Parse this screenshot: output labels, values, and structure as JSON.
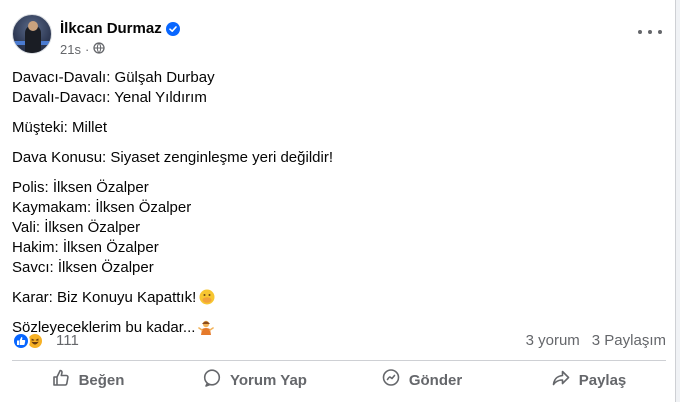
{
  "post": {
    "author": "İlkcan Durmaz",
    "time": "21s",
    "lines": {
      "p1a": "Davacı-Davalı: Gülşah Durbay",
      "p1b": "Davalı-Davacı: Yenal Yıldırım",
      "p2": "Müşteki: Millet",
      "p3": "Dava Konusu: Siyaset zenginleşme yeri değildir!",
      "p4a": "Polis: İlksen Özalper",
      "p4b": "Kaymakam: İlksen Özalper",
      "p4c": "Vali: İlksen Özalper",
      "p4d": "Hakim: İlksen Özalper",
      "p4e": "Savcı: İlksen Özalper",
      "p5": "Karar: Biz Konuyu Kapattık!",
      "p6": "Sözleyeceklerim bu kadar..."
    }
  },
  "reactions": {
    "icons": [
      "like-icon",
      "haha-icon"
    ],
    "count": "111",
    "comments": "3 yorum",
    "shares": "3 Paylaşım"
  },
  "actions": {
    "like": "Beğen",
    "comment": "Yorum Yap",
    "send": "Gönder",
    "share": "Paylaş"
  },
  "colors": {
    "accent": "#0866ff",
    "muted": "#65676b",
    "haha": "#f7b125"
  }
}
